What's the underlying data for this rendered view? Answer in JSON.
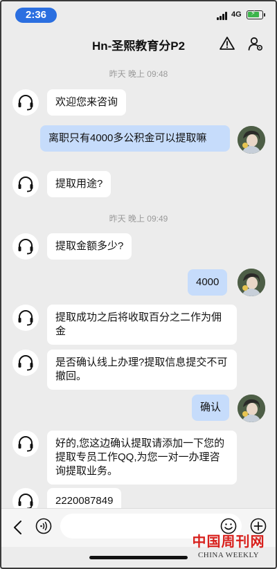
{
  "status_bar": {
    "time": "2:36",
    "network": "4G",
    "colors": {
      "time_pill": "#2b6fe0",
      "battery": "#3bb44a"
    }
  },
  "header": {
    "title": "Hn-圣熙教育分P2",
    "icons": [
      "warning-icon",
      "contact-settings-icon"
    ]
  },
  "chat": {
    "timestamps": [
      "昨天 晚上 09:48",
      "昨天 晚上 09:49"
    ],
    "messages": [
      {
        "from": "agent",
        "text": "欢迎您来咨询"
      },
      {
        "from": "user",
        "text": "离职只有4000多公积金可以提取嘛"
      },
      {
        "from": "agent",
        "text": "提取用途?"
      },
      {
        "from": "agent",
        "text": "提取金额多少?"
      },
      {
        "from": "user",
        "text": "4000"
      },
      {
        "from": "agent",
        "text": "提取成功之后将收取百分之二作为佣金"
      },
      {
        "from": "agent",
        "text": "是否确认线上办理?提取信息提交不可撤回。"
      },
      {
        "from": "user",
        "text": "确认"
      },
      {
        "from": "agent",
        "text": "好的,您这边确认提取请添加一下您的提取专员工作QQ,为您一对一办理咨询提取业务。"
      },
      {
        "from": "agent",
        "text": "2220087849"
      }
    ],
    "colors": {
      "user_bubble": "#c6dcfb",
      "agent_bubble": "#ffffff",
      "background": "#ececec"
    }
  },
  "input_bar": {
    "value": "",
    "placeholder": "",
    "icons": [
      "back-icon",
      "voice-icon",
      "emoji-icon",
      "plus-icon"
    ]
  },
  "watermark": {
    "cn": "中国周刊网",
    "en": "CHINA WEEKLY",
    "color": "#d8201c"
  }
}
